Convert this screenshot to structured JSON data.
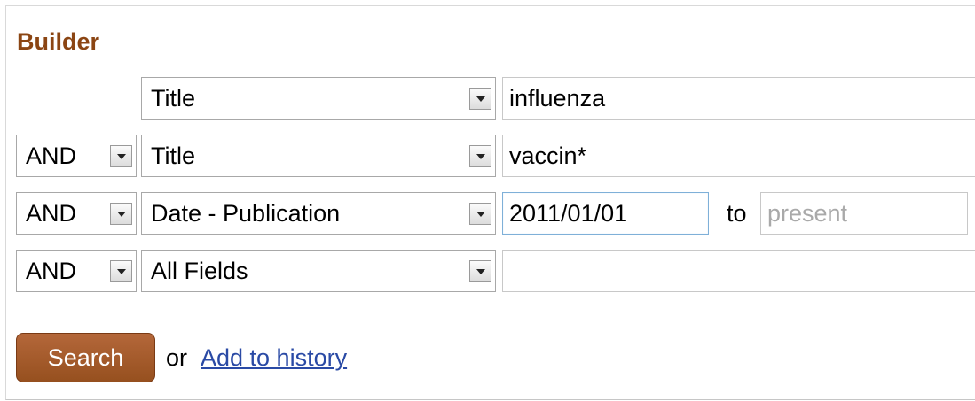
{
  "builder": {
    "title": "Builder",
    "rows": [
      {
        "operator": "",
        "field": "Title",
        "term": "influenza"
      },
      {
        "operator": "AND",
        "field": "Title",
        "term": "vaccin*"
      },
      {
        "operator": "AND",
        "field": "Date - Publication",
        "term": "2011/01/01",
        "to_label": "to",
        "end_placeholder": "present"
      },
      {
        "operator": "AND",
        "field": "All Fields",
        "term": ""
      }
    ]
  },
  "actions": {
    "search_label": "Search",
    "or_text": "or",
    "add_history_label": "Add to history"
  },
  "colors": {
    "title": "#8b4513",
    "search_button": "#a75d2c",
    "link": "#2a4aa5"
  },
  "icons": [
    "dropdown-arrow-icon"
  ]
}
